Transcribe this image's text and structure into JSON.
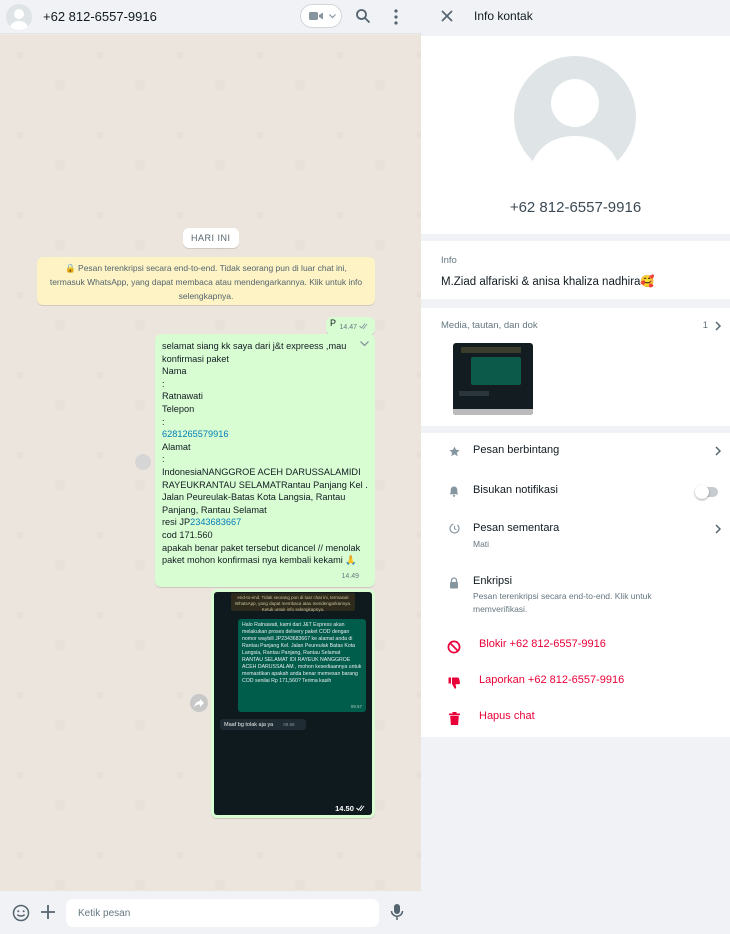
{
  "chat": {
    "header": {
      "contact_name": "+62 812-6557-9916"
    },
    "day_label": "HARI INI",
    "encryption_note": "🔒 Pesan terenkripsi secara end-to-end. Tidak seorang pun di luar chat ini, termasuk WhatsApp, yang dapat membaca atau mendengarkannya. Klik untuk info selengkapnya.",
    "messages": [
      {
        "text": "P",
        "time": "14.47"
      },
      {
        "lines": [
          "selamat siang kk saya dari j&t expreess ,mau",
          "konfirmasi paket",
          "Nama",
          ":",
          "Ratnawati",
          "Telepon",
          ":",
          "6281265579916",
          "Alamat",
          ":",
          "IndonesiaNANGGROE ACEH DARUSSALAMIDI",
          "RAYEUKRANTAU SELAMATRantau Panjang Kel .",
          "Jalan Peureulak-Batas Kota Langsia, Rantau",
          "Panjang, Rantau Selamat",
          "resi JP2343683667",
          "cod 171.560",
          "apakah benar paket tersebut  dicancel // menolak",
          "paket mohon konfirmasi nya kembali kekami 🙏"
        ],
        "time": "14.49"
      },
      {
        "image": {
          "enc_note": "end-to-end. Tidak seorang pun di luar chat ini, termasuk WhatsApp, yang dapat membaca atau mendengarkannya. Ketuk untuk info selengkapnya.",
          "green_text": "Halo Ratnawati, kami dari J&T Express akan melakukan proses delivery paket COD dengan nomor waybill JP2343683667 ke alamat anda di Rantau Panjang Kel. Jalan Peureulak Batas Kota Langsia, Rantau Panjang, Rantau Selamat RANTAU SELAMAT IDI RAYEUK NANGGROE ACEH DARUSSALAM , mohon kesediaannya untuk memastikan apakah anda benar memesan barang COD senilai Rp 171,560? Terima kasih",
          "green_time": "09.57",
          "gray_text": "Maaf bg tolak aja ya",
          "gray_time": "09.58"
        },
        "time": "14.50"
      }
    ],
    "composer": {
      "placeholder": "Ketik pesan"
    }
  },
  "info": {
    "title": "Info kontak",
    "phone": "+62 812-6557-9916",
    "about_label": "Info",
    "about_text": "M.Ziad alfariski & anisa khaliza nadhira🥰",
    "media_label": "Media, tautan, dan dok",
    "media_count": "1",
    "settings": {
      "starred": "Pesan berbintang",
      "mute": "Bisukan notifikasi",
      "mute_enabled": false,
      "disappearing": "Pesan sementara",
      "disappearing_sub": "Mati",
      "encryption": "Enkripsi",
      "encryption_sub": "Pesan terenkripsi secara end-to-end. Klik untuk memverifikasi.",
      "block": "Blokir +62 812-6557-9916",
      "report": "Laporkan +62 812-6557-9916",
      "delete": "Hapus chat"
    }
  },
  "colors": {
    "outgoing_bubble": "#d9fdd3",
    "link": "#027eb5",
    "danger": "#ea0038",
    "panel_bg": "#f0f2f5"
  },
  "icons": [
    "default-avatar-icon",
    "video-call-icon",
    "chevron-down-icon",
    "search-icon",
    "menu-icon",
    "double-check-icon",
    "forward-icon",
    "emoji-icon",
    "plus-icon",
    "mic-icon",
    "close-icon",
    "chevron-right-icon",
    "star-icon",
    "bell-icon",
    "timer-icon",
    "lock-icon",
    "block-icon",
    "thumbs-down-icon",
    "trash-icon"
  ]
}
